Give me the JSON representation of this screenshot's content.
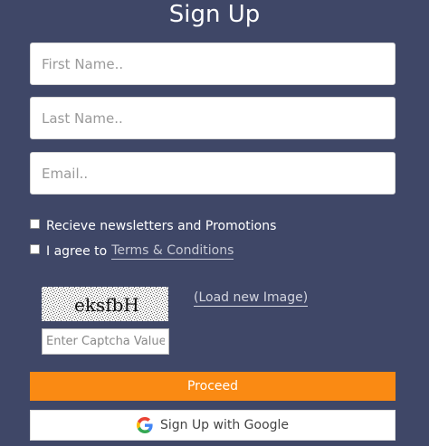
{
  "page": {
    "title": "Sign Up"
  },
  "form": {
    "first_name": {
      "value": "",
      "placeholder": "First Name.."
    },
    "last_name": {
      "value": "",
      "placeholder": "Last Name.."
    },
    "email": {
      "value": "",
      "placeholder": "Email.."
    }
  },
  "checks": {
    "newsletter_label": "Recieve newsletters and Promotions",
    "newsletter_checked": false,
    "terms_prefix": "I agree to",
    "terms_link": "Terms & Conditions",
    "terms_checked": false
  },
  "captcha": {
    "image_text": "eksfbH",
    "load_new_label": "(Load new Image)",
    "input_placeholder": "Enter Captcha Value",
    "input_value": ""
  },
  "buttons": {
    "proceed_label": "Proceed",
    "google_label": "Sign Up with Google",
    "google_icon": "google-g-icon"
  },
  "colors": {
    "background": "#3f4767",
    "proceed": "#fa8a13"
  }
}
